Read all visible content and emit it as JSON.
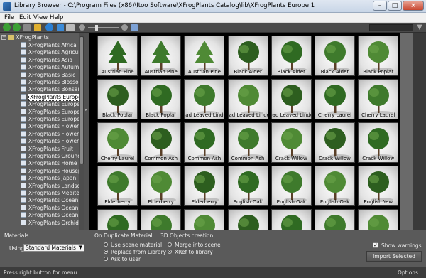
{
  "window": {
    "title": "Library Browser - C:\\Program Files (x86)\\Itoo Software\\XFrogPlants Catalog\\lib\\XFrogPlants Europe 1"
  },
  "menu": [
    "File",
    "Edit",
    "View",
    "Help"
  ],
  "toolbar": {
    "icons": [
      "back-arrow-icon",
      "forward-arrow-icon",
      "stop-icon",
      "folder-icon",
      "refresh-icon",
      "download-icon",
      "img-view-icon",
      "zoom-out-icon",
      "zoom-in-icon",
      "info-icon",
      "filter-icon"
    ],
    "search_placeholder": ""
  },
  "tree": {
    "root": "XFrogPlants",
    "items": [
      "XFrogPlants Africa",
      "XFrogPlants Agricultur",
      "XFrogPlants Asia",
      "XFrogPlants Autumn",
      "XFrogPlants Basic",
      "XFrogPlants Blossomin",
      "XFrogPlants Bonsai",
      "XFrogPlants Europe 1",
      "XFrogPlants Europe 2",
      "XFrogPlants Europe 3-",
      "XFrogPlants Europe 3-",
      "XFrogPlants Flowers 1",
      "XFrogPlants Flowers 2",
      "XFrogPlants Flowers 3",
      "XFrogPlants Fruit",
      "XFrogPlants Groundco",
      "XFrogPlants Home Gar",
      "XFrogPlants Houseplar",
      "XFrogPlants Japan",
      "XFrogPlants Landscapi",
      "XFrogPlants Mediterrar",
      "XFrogPlants Oceania 1",
      "XFrogPlants Oceania 2",
      "XFrogPlants Oceania 3",
      "XFrogPlants Orchids"
    ],
    "selected_index": 7
  },
  "thumbnails": [
    "Austrian Pine",
    "Austrian Pine",
    "Austrian Pine",
    "Black Alder",
    "Black Alder",
    "Black Alder",
    "Black Poplar",
    "Black Poplar",
    "Black Poplar",
    "oad Leaved Linde",
    "oad Leaved Linde",
    "oad Leaved Linde",
    "Cherry Laurel",
    "Cherry Laurel",
    "Cherry Laurel",
    "Common Ash",
    "Common Ash",
    "Common Ash",
    "Crack Willow",
    "Crack Willow",
    "Crack Willow",
    "Elderberry",
    "Elderberry",
    "Elderberry",
    "English Oak",
    "English Oak",
    "English Oak",
    "English Yew",
    "",
    "",
    "",
    "",
    "",
    "",
    ""
  ],
  "bottom": {
    "materials_label": "Materials",
    "using_label": "Using",
    "materials_value": "Standard Materials",
    "duplicate_label": "On Duplicate Material:",
    "duplicate_options": [
      "Use scene material",
      "Replace from Library",
      "Ask to user"
    ],
    "duplicate_selected": 1,
    "objects_label": "3D Objects creation",
    "objects_options": [
      "Merge into scene",
      "XRef to library"
    ],
    "objects_selected": 1,
    "show_warnings_label": "Show warnings",
    "show_warnings_checked": true,
    "import_button": "Import Selected"
  },
  "status": {
    "left": "Press right button for menu",
    "right": "Options"
  },
  "colors": {
    "panel": "#5c5c5c",
    "grid_bg": "#000000",
    "selected_bg": "#ffffff",
    "accent_green": "#3ca035"
  }
}
